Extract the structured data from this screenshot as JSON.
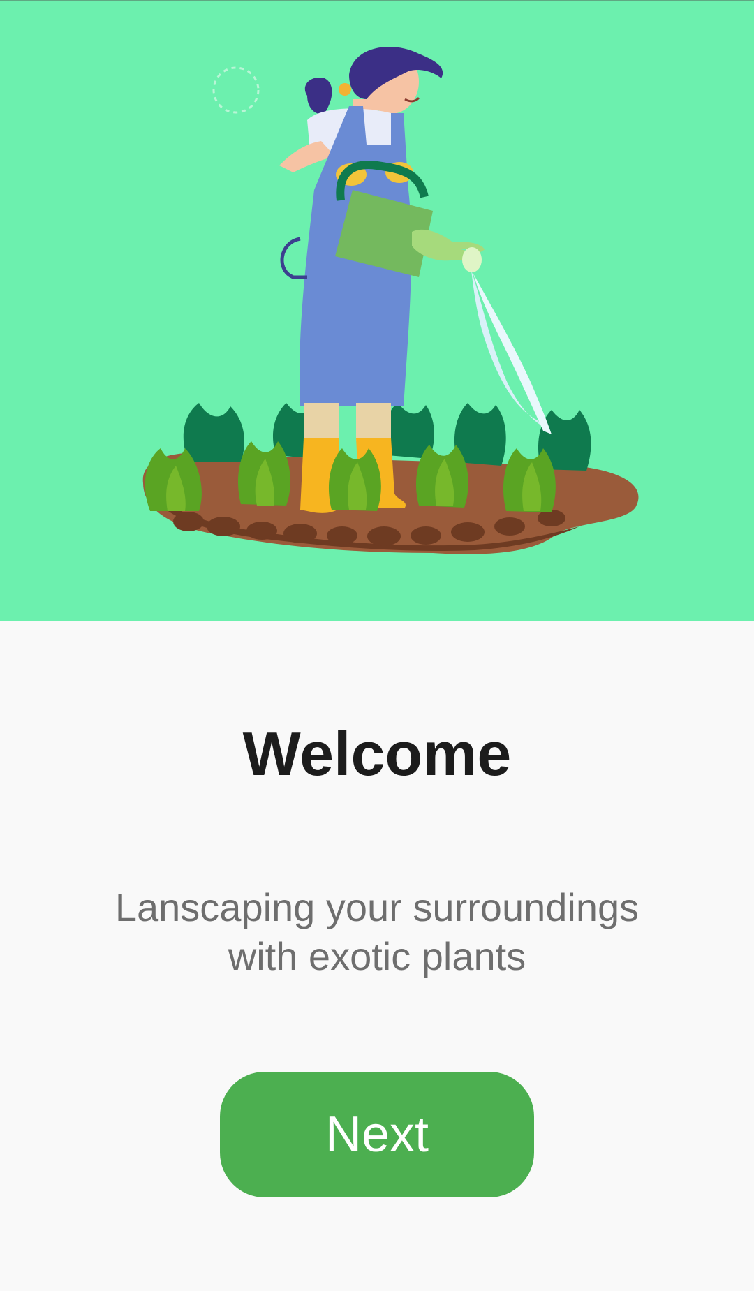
{
  "hero": {
    "image_name": "gardener-watering-plants-illustration",
    "background_color": "#6cf0ae"
  },
  "onboarding": {
    "title": "Welcome",
    "subtitle_line1": "Lanscaping your surroundings",
    "subtitle_line2": "with exotic plants",
    "next_label": "Next",
    "button_color": "#4caf50"
  }
}
